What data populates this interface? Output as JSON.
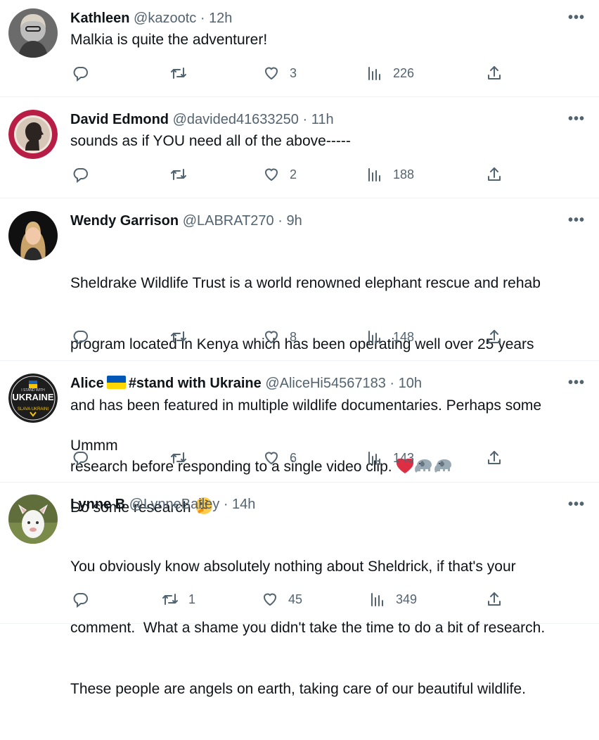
{
  "tweets": [
    {
      "name": "Kathleen",
      "handle": "@kazootc",
      "time": "12h",
      "text": "Malkia is quite the adventurer!",
      "replies": "",
      "retweets": "",
      "likes": "3",
      "views": "226"
    },
    {
      "name": "David Edmond",
      "handle": "@davided41633250",
      "time": "11h",
      "text": "sounds as if YOU need all of the above-----",
      "replies": "",
      "retweets": "",
      "likes": "2",
      "views": "188"
    },
    {
      "name": "Wendy Garrison",
      "handle": "@LABRAT270",
      "time": "9h",
      "text_line1": "Sheldrake Wildlife Trust is a world renowned elephant rescue and rehab",
      "text_line2": "program located in Kenya which has been operating well over 25 years",
      "text_line3": "and has been featured in multiple wildlife documentaries. Perhaps some",
      "text_line4": "research before responding to a single video clip.",
      "replies": "",
      "retweets": "",
      "likes": "8",
      "views": "148"
    },
    {
      "name_part1": "Alice",
      "name_part2": "#stand with Ukraine",
      "handle": "@AliceHi54567183",
      "time": "10h",
      "text_line1": "Ummm",
      "text_line2": "Do some research",
      "replies": "",
      "retweets": "",
      "likes": "6",
      "views": "143"
    },
    {
      "name": "Lynne B",
      "handle": "@LynneBailey",
      "time": "14h",
      "text_line1": "You obviously know absolutely nothing about Sheldrick, if that's your",
      "text_line2": "comment.  What a shame you didn't take the time to do a bit of research.",
      "text_line3": "These people are angels on earth, taking care of our beautiful wildlife.",
      "replies": "",
      "retweets": "1",
      "likes": "45",
      "views": "349"
    }
  ],
  "ui": {
    "dot": "·",
    "more": "•••"
  },
  "avatar_badge": {
    "line1": "I STAND WITH",
    "line2": "UKRAINE",
    "line3": "SLAVA UKRAINI"
  },
  "colors": {
    "text": "#0f1419",
    "secondary": "#536471",
    "divider": "#eff3f4",
    "heart": "#f91880"
  },
  "icons": [
    "reply-icon",
    "retweet-icon",
    "like-icon",
    "views-icon",
    "share-icon",
    "more-icon"
  ]
}
